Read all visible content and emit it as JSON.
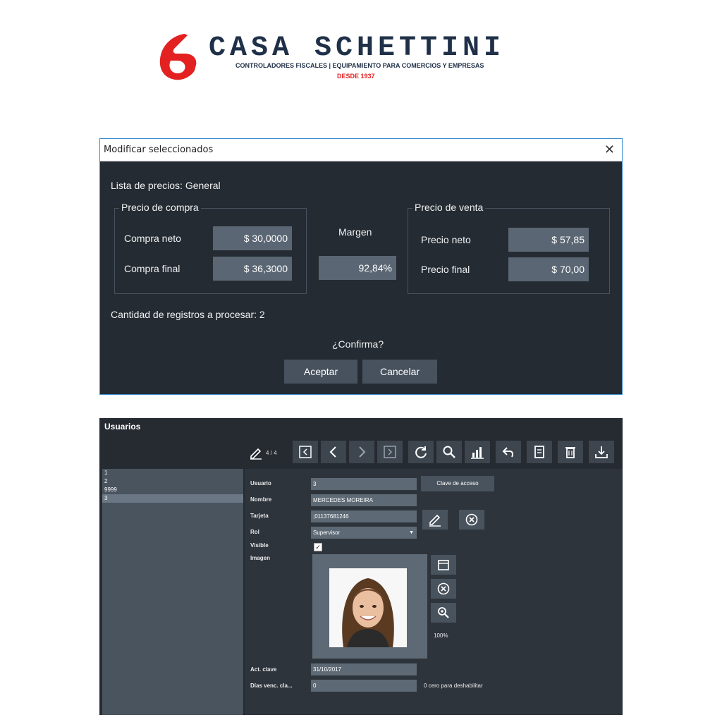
{
  "logo": {
    "title": "CASA SCHETTINI",
    "subtitle": "CONTROLADORES FISCALES |  EQUIPAMIENTO PARA COMERCIOS Y EMPRESAS",
    "since": "DESDE 1937",
    "mark_color": "#e32121",
    "title_color": "#1f3048"
  },
  "dialog": {
    "title": "Modificar seleccionados",
    "close_icon": "close-icon",
    "price_list": "Lista de precios: General",
    "purchase_group": {
      "legend": "Precio de compra",
      "net_label": "Compra neto",
      "net_value": "$ 30,0000",
      "final_label": "Compra final",
      "final_value": "$ 36,3000"
    },
    "margin": {
      "label": "Margen",
      "value": "92,84%"
    },
    "sale_group": {
      "legend": "Precio de venta",
      "net_label": "Precio neto",
      "net_value": "$ 57,85",
      "final_label": "Precio final",
      "final_value": "$ 70,00"
    },
    "records": "Cantidad de registros a procesar: 2",
    "confirm": "¿Confirma?",
    "accept_label": "Aceptar",
    "cancel_label": "Cancelar"
  },
  "users": {
    "title": "Usuarios",
    "toolbar": {
      "record_count": "4 / 4",
      "icons": [
        "first-record-icon",
        "previous-icon",
        "next-icon",
        "last-record-icon",
        "refresh-icon",
        "search-icon",
        "chart-icon",
        "undo-icon",
        "copy-document-icon",
        "trash-icon",
        "download-icon"
      ]
    },
    "list": [
      "1",
      "2",
      "9999",
      "3"
    ],
    "selected_index": 3,
    "form": {
      "usuario_label": "Usuario",
      "usuario_value": "3",
      "clave_button": "Clave de acceso",
      "nombre_label": "Nombre",
      "nombre_value": "MERCEDES MOREIRA",
      "tarjeta_label": "Tarjeta",
      "tarjeta_value": ";01137681246",
      "rol_label": "Rol",
      "rol_value": "Supervisor",
      "visible_label": "Visible",
      "visible_checked": true,
      "imagen_label": "Imagen",
      "zoom": "100%",
      "act_clave_label": "Act. clave",
      "act_clave_value": "31/10/2017",
      "dias_label": "Días venc. cla...",
      "dias_value": "0",
      "dias_hint": "0 cero para deshabilitar"
    }
  }
}
